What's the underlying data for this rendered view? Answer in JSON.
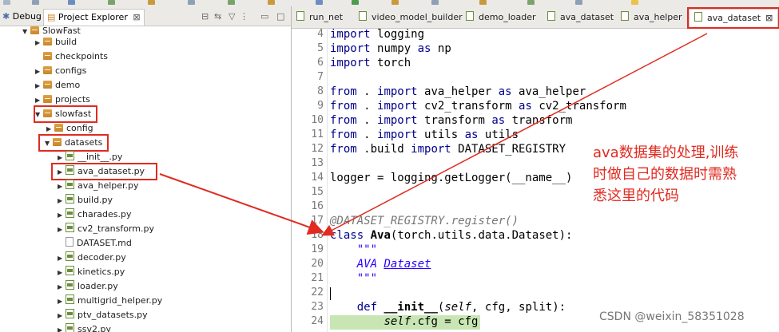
{
  "left_tabs": {
    "debug": "Debug",
    "project_explorer": "Project Explorer"
  },
  "tree": [
    {
      "label": "SlowFast",
      "kind": "folder",
      "arrow": "▼"
    },
    {
      "label": "build",
      "kind": "folder",
      "arrow": "▶"
    },
    {
      "label": "checkpoints",
      "kind": "folder",
      "arrow": ""
    },
    {
      "label": "configs",
      "kind": "folder",
      "arrow": "▶"
    },
    {
      "label": "demo",
      "kind": "folder",
      "arrow": "▶"
    },
    {
      "label": "projects",
      "kind": "folder",
      "arrow": "▶"
    },
    {
      "label": "slowfast",
      "kind": "folder",
      "arrow": "▼"
    },
    {
      "label": "config",
      "kind": "folder",
      "arrow": "▶"
    },
    {
      "label": "datasets",
      "kind": "folder",
      "arrow": "▼"
    },
    {
      "label": "__init__.py",
      "kind": "py",
      "arrow": "▶"
    },
    {
      "label": "ava_dataset.py",
      "kind": "py",
      "arrow": "▶"
    },
    {
      "label": "ava_helper.py",
      "kind": "py",
      "arrow": "▶"
    },
    {
      "label": "build.py",
      "kind": "py",
      "arrow": "▶"
    },
    {
      "label": "charades.py",
      "kind": "py",
      "arrow": "▶"
    },
    {
      "label": "cv2_transform.py",
      "kind": "py",
      "arrow": "▶"
    },
    {
      "label": "DATASET.md",
      "kind": "text",
      "arrow": ""
    },
    {
      "label": "decoder.py",
      "kind": "py",
      "arrow": "▶"
    },
    {
      "label": "kinetics.py",
      "kind": "py",
      "arrow": "▶"
    },
    {
      "label": "loader.py",
      "kind": "py",
      "arrow": "▶"
    },
    {
      "label": "multigrid_helper.py",
      "kind": "py",
      "arrow": "▶"
    },
    {
      "label": "ptv_datasets.py",
      "kind": "py",
      "arrow": "▶"
    },
    {
      "label": "ssv2.py",
      "kind": "py",
      "arrow": "▶"
    }
  ],
  "editor_tabs": [
    "run_net",
    "video_model_builder",
    "demo_loader",
    "ava_dataset",
    "ava_helper",
    "ava_dataset"
  ],
  "code_lines": [
    {
      "n": "4",
      "text": "import logging"
    },
    {
      "n": "5",
      "text": "import numpy as np"
    },
    {
      "n": "6",
      "text": "import torch"
    },
    {
      "n": "7",
      "text": ""
    },
    {
      "n": "8",
      "text": "from . import ava_helper as ava_helper"
    },
    {
      "n": "9",
      "text": "from . import cv2_transform as cv2_transform"
    },
    {
      "n": "10",
      "text": "from . import transform as transform"
    },
    {
      "n": "11",
      "text": "from . import utils as utils"
    },
    {
      "n": "12",
      "text": "from .build import DATASET_REGISTRY"
    },
    {
      "n": "13",
      "text": ""
    },
    {
      "n": "14",
      "text": "logger = logging.getLogger(__name__)"
    },
    {
      "n": "15",
      "text": ""
    },
    {
      "n": "16",
      "text": ""
    },
    {
      "n": "17",
      "text": "@DATASET_REGISTRY.register()"
    },
    {
      "n": "18",
      "text": "class Ava(torch.utils.data.Dataset):"
    },
    {
      "n": "19",
      "text": "    \"\"\""
    },
    {
      "n": "20",
      "text": "    AVA Dataset"
    },
    {
      "n": "21",
      "text": "    \"\"\""
    },
    {
      "n": "22",
      "text": ""
    },
    {
      "n": "23",
      "text": "    def __init__(self, cfg, split):"
    },
    {
      "n": "24",
      "text": "        self.cfg = cfg"
    }
  ],
  "annotation": [
    "ava数据集的处理,训练",
    "时做自己的数据时需熟",
    "悉这里的代码"
  ],
  "watermark": "CSDN @weixin_58351028",
  "colors": {
    "highlight": "#e02b20",
    "keyword": "#00008b",
    "current_line": "#c7e6b3"
  }
}
